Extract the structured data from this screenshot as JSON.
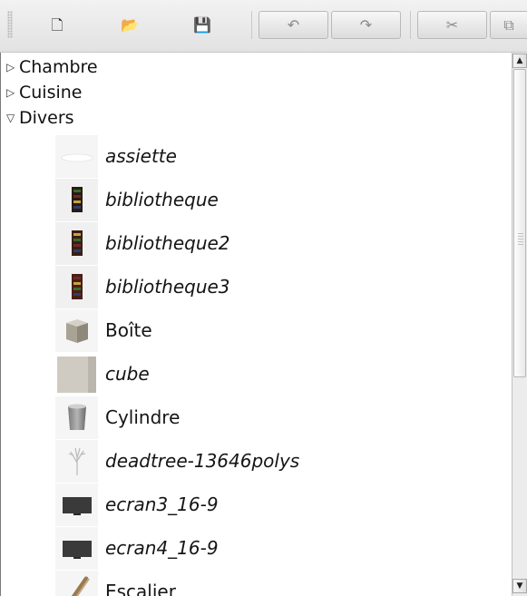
{
  "toolbar": {
    "buttons": [
      {
        "icon": "new-furniture-icon",
        "glyph": "🗋"
      },
      {
        "icon": "open-icon",
        "glyph": "📂"
      },
      {
        "icon": "save-icon",
        "glyph": "💾"
      },
      {
        "icon": "undo-icon",
        "glyph": "↶"
      },
      {
        "icon": "redo-icon",
        "glyph": "↷"
      },
      {
        "icon": "cut-icon",
        "glyph": "✂"
      },
      {
        "icon": "copy-icon",
        "glyph": "⧉"
      }
    ]
  },
  "tree": {
    "categories": [
      {
        "label": "Chambre",
        "expanded": false
      },
      {
        "label": "Cuisine",
        "expanded": false
      },
      {
        "label": "Divers",
        "expanded": true
      }
    ],
    "items": [
      {
        "label": "assiette",
        "italic": true,
        "icon": "plate-icon"
      },
      {
        "label": "bibliotheque",
        "italic": true,
        "icon": "bookcase-icon"
      },
      {
        "label": "bibliotheque2",
        "italic": true,
        "icon": "bookcase-icon"
      },
      {
        "label": "bibliotheque3",
        "italic": true,
        "icon": "bookcase-icon"
      },
      {
        "label": "Boîte",
        "italic": false,
        "icon": "box-icon"
      },
      {
        "label": "cube",
        "italic": true,
        "icon": "cube-icon"
      },
      {
        "label": "Cylindre",
        "italic": false,
        "icon": "cylinder-icon"
      },
      {
        "label": "deadtree-13646polys",
        "italic": true,
        "icon": "tree-icon"
      },
      {
        "label": "ecran3_16-9",
        "italic": true,
        "icon": "screen-icon"
      },
      {
        "label": "ecran4_16-9",
        "italic": true,
        "icon": "screen-icon"
      },
      {
        "label": "Escalier",
        "italic": false,
        "icon": "stairs-icon"
      }
    ]
  },
  "scrollbar": {
    "up_glyph": "▲",
    "down_glyph": "▼"
  }
}
